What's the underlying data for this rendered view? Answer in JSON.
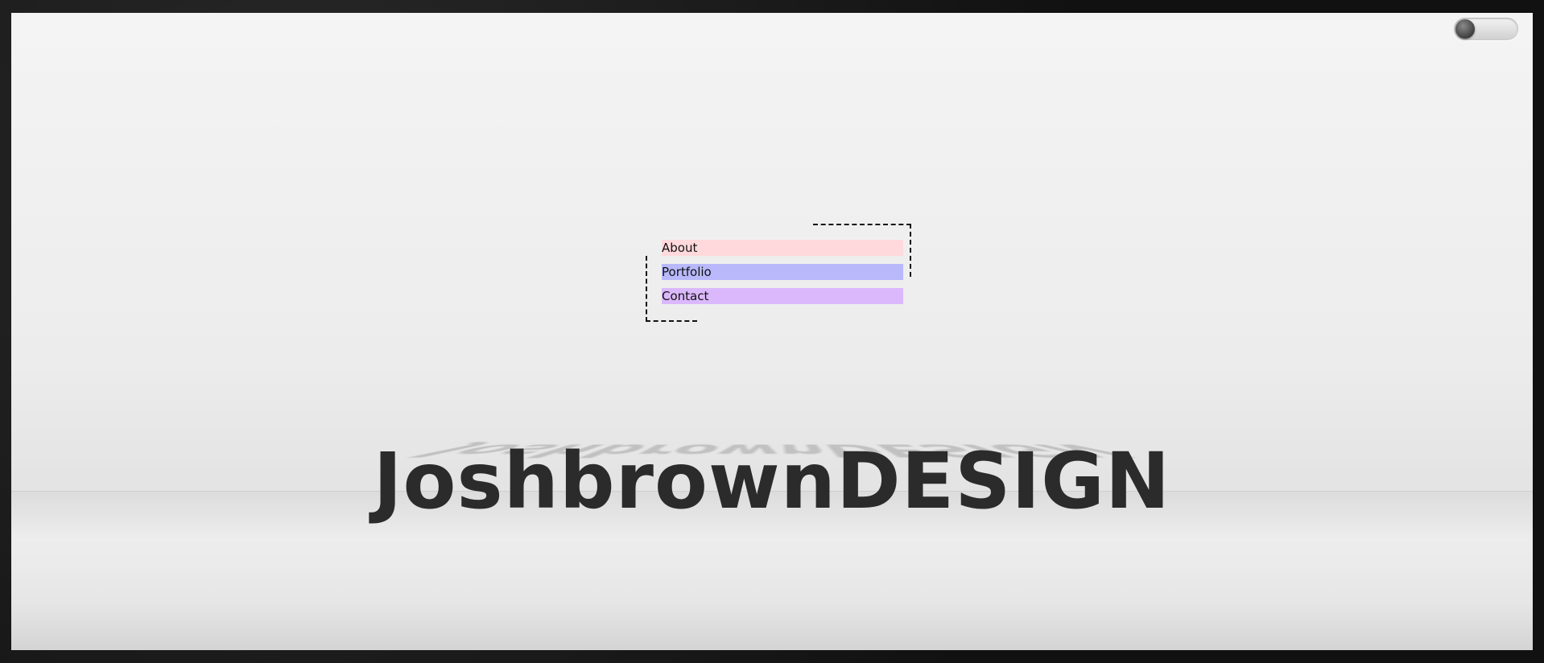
{
  "brand": {
    "logo_text": "JoshbrownDESIGN"
  },
  "theme_toggle": {
    "state": "off"
  },
  "nav": {
    "items": [
      {
        "label": "About",
        "color": "#ffd9dc"
      },
      {
        "label": "Portfolio",
        "color": "#b8b8fb"
      },
      {
        "label": "Contact",
        "color": "#dbb8fb"
      }
    ]
  },
  "colors": {
    "frame": "#151515",
    "stage": "#ececec",
    "logo": "#2b2b2b"
  }
}
